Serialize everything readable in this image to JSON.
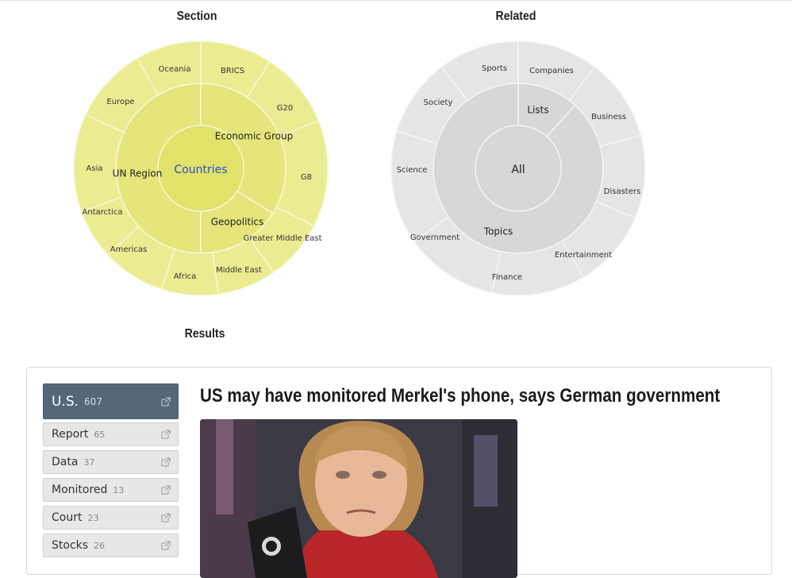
{
  "section": {
    "title": "Section",
    "center_label": "Countries",
    "middle_ring": [
      "UN Region",
      "Economic Group",
      "Geopolitics"
    ],
    "outer_ring": [
      "Oceania",
      "BRICS",
      "G20",
      "G8",
      "Greater Middle East",
      "Middle East",
      "Africa",
      "Americas",
      "Antarctica",
      "Asia",
      "Europe"
    ],
    "colors": {
      "center": "#e0e26a",
      "middle": "#e5e57c",
      "outer": "#ebeb91",
      "stroke": "#f7f7d8"
    }
  },
  "related": {
    "title": "Related",
    "center_label": "All",
    "middle_ring": [
      "Lists",
      "Topics"
    ],
    "outer_ring": [
      "Sports",
      "Companies",
      "Business",
      "Disasters",
      "Entertainment",
      "Finance",
      "Government",
      "Science",
      "Society"
    ],
    "colors": {
      "center": "#d6d7d9",
      "middle": "#d6d7d9",
      "outer": "#e4e5e7",
      "stroke": "#f4f4f5"
    }
  },
  "results": {
    "title": "Results",
    "tags": [
      {
        "label": "U.S.",
        "count": "607",
        "active": true
      },
      {
        "label": "Report",
        "count": "65"
      },
      {
        "label": "Data",
        "count": "37"
      },
      {
        "label": "Monitored",
        "count": "13"
      },
      {
        "label": "Court",
        "count": "23"
      },
      {
        "label": "Stocks",
        "count": "26"
      }
    ],
    "article": {
      "headline": "US may have monitored Merkel's phone, says German government",
      "image_icon": "news-photo"
    }
  }
}
